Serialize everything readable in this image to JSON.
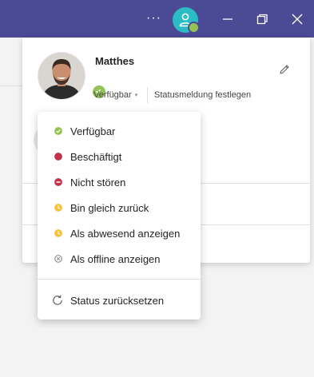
{
  "colors": {
    "titlebar": "#4b4a95",
    "available": "#92c353",
    "busy": "#c4314b",
    "away": "#f8c13a",
    "offline": "#8a8886",
    "avatar_bg": "#2bbcc6"
  },
  "titlebar": {
    "more_label": "···",
    "icons": [
      "more-icon",
      "user-avatar-icon",
      "minimize-icon",
      "maximize-icon",
      "close-icon"
    ]
  },
  "profile": {
    "name": "Matthes",
    "status_label": "Verfügbar",
    "status_message_label": "Statusmeldung festlegen",
    "icons": [
      "profile-photo",
      "available-status-icon",
      "edit-pencil-icon",
      "chevron-down-icon"
    ]
  },
  "status_menu": {
    "items": [
      {
        "label": "Verfügbar",
        "icon": "available-icon"
      },
      {
        "label": "Beschäftigt",
        "icon": "busy-icon"
      },
      {
        "label": "Nicht stören",
        "icon": "do-not-disturb-icon"
      },
      {
        "label": "Bin gleich zurück",
        "icon": "be-right-back-icon"
      },
      {
        "label": "Als abwesend anzeigen",
        "icon": "away-icon"
      },
      {
        "label": "Als offline anzeigen",
        "icon": "offline-icon"
      }
    ],
    "reset_label": "Status zurücksetzen",
    "reset_icon": "reset-icon"
  }
}
